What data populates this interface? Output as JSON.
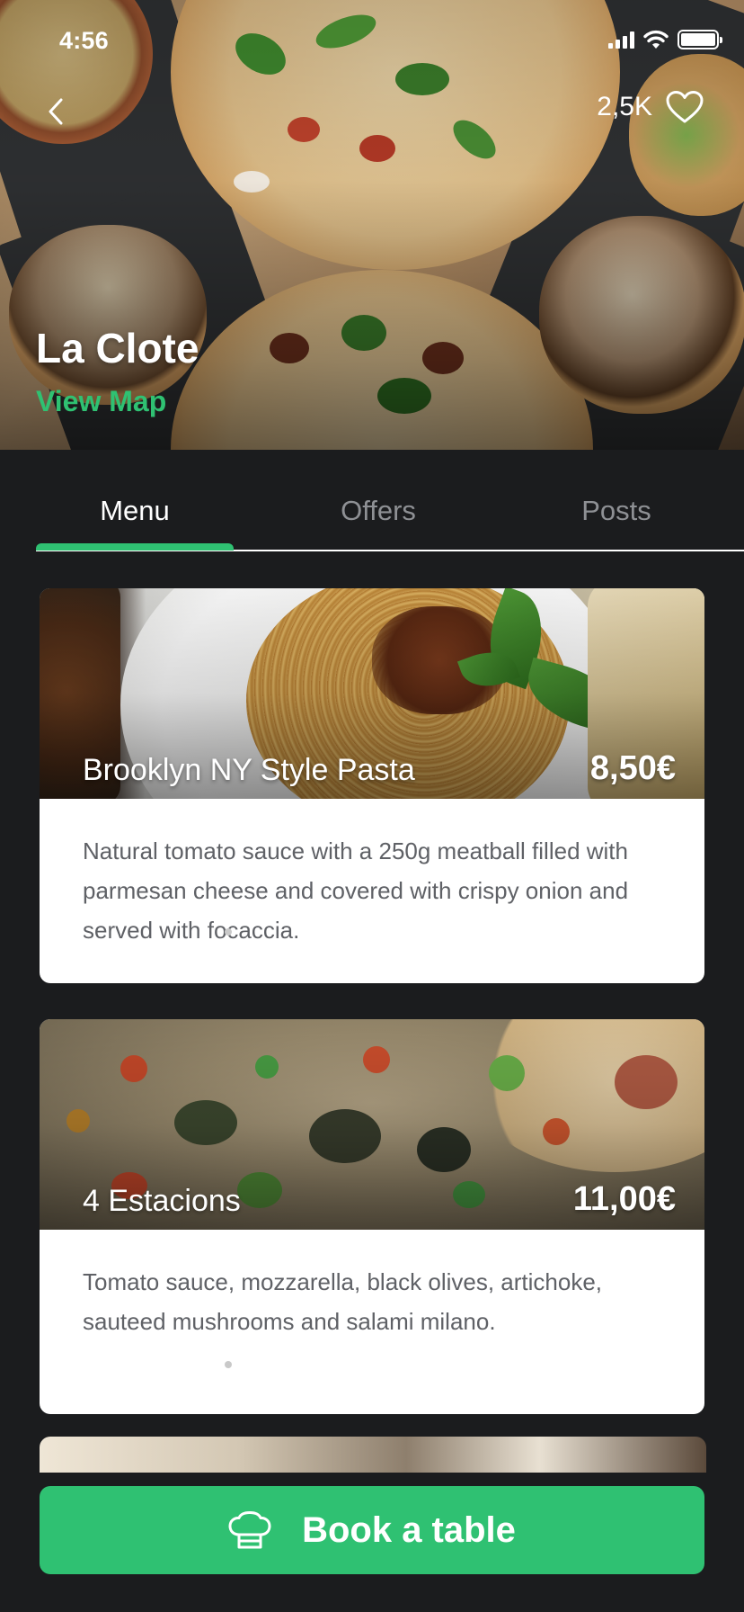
{
  "status_bar": {
    "time": "4:56"
  },
  "header": {
    "restaurant_name": "La Clote",
    "view_map_label": "View Map",
    "likes_count": "2,5K"
  },
  "tabs": [
    {
      "label": "Menu",
      "active": true
    },
    {
      "label": "Offers",
      "active": false
    },
    {
      "label": "Posts",
      "active": false
    }
  ],
  "menu_items": [
    {
      "name": "Brooklyn NY Style Pasta",
      "price": "8,50€",
      "description": "Natural tomato sauce with a 250g meatball filled with parmesan cheese and covered with crispy onion and served with focaccia."
    },
    {
      "name": "4 Estacions",
      "price": "11,00€",
      "description": "Tomato sauce, mozzarella, black olives, artichoke, sauteed mushrooms and salami milano."
    }
  ],
  "book_button": {
    "label": "Book a table"
  },
  "colors": {
    "accent": "#2fc172",
    "background": "#1b1c1e",
    "card": "#ffffff",
    "muted_tab": "#8e9094"
  },
  "icons": {
    "back": "chevron-left-icon",
    "like": "heart-outline-icon",
    "book": "chef-hat-icon"
  }
}
